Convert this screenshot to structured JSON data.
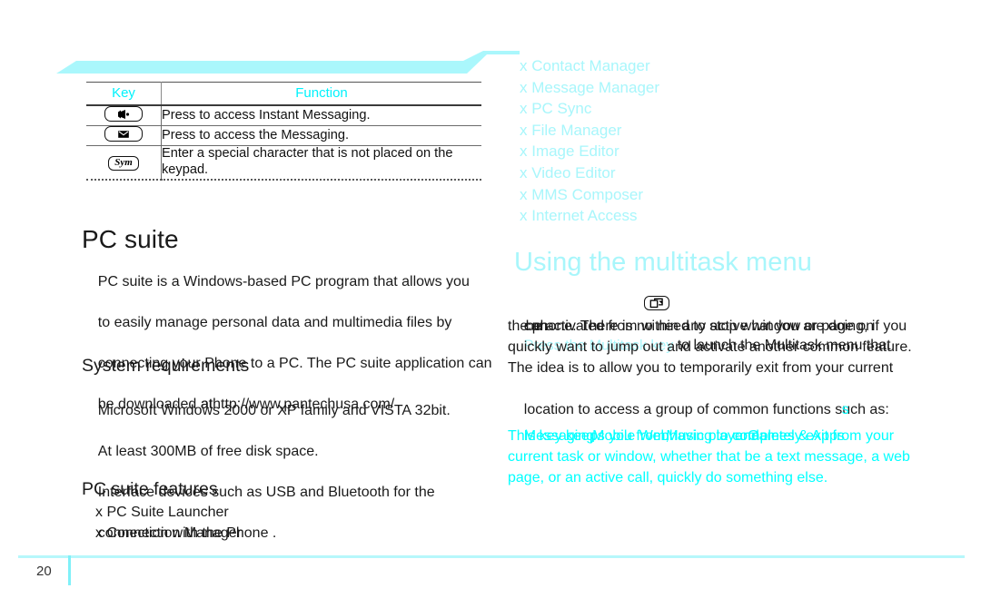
{
  "document": {
    "page_number": "20"
  },
  "banner": {
    "color": "#aaf7fc"
  },
  "key_table": {
    "headers": {
      "key": "Key",
      "function": "Function"
    },
    "header_color": "#00f2fc",
    "rows": [
      {
        "key_icon": "instant-messaging-key-icon",
        "key_label": "",
        "function": "Press to access Instant Messaging."
      },
      {
        "key_icon": "envelope-message-key-icon",
        "key_label": "",
        "function": "Press to access the Messaging."
      },
      {
        "key_icon": "sym-key-icon",
        "key_label": "Sym",
        "function": "Enter a special character that is not placed on the keypad."
      }
    ]
  },
  "left_column": {
    "pc_suite_heading": "PC suite",
    "pc_suite_body_line1": "PC suite is a Windows-based PC program that allows you",
    "pc_suite_body_line2": "to easily manage personal data and multimedia files by",
    "pc_suite_body_line3": "connecting your Phone to a PC. The PC suite application can",
    "pc_suite_body_line4_a": "be downloaded at",
    "pc_suite_body_line4_overlap": "at",
    "pc_suite_body_line4_b": "http://www.pantechusa.com/",
    "system_requirements_heading": "System requirements",
    "system_requirements_lines": [
      "Microsoft Windows 2000 or XP family and VISTA 32bit.",
      "At least 300MB of free disk space.",
      "Interface devices such as USB and Bluetooth for the",
      "connection with the Phone ."
    ],
    "pc_suite_features_heading": "PC suite features",
    "pc_suite_features_items": [
      "x PC Suite Launcher",
      "x Connection Manager"
    ]
  },
  "right_column": {
    "feature_list": [
      "x Contact Manager",
      "x Message Manager",
      "x PC Sync",
      "x File Manager",
      "x Image Editor",
      "x Video Editor",
      "x MMS Composer",
      "x Internet Access"
    ],
    "multitask_heading": "Using the multitask menu",
    "multitask_intro_cyan": "Press the Multitask key",
    "multitask_key_icon": "multitask-key-icon",
    "multitask_body_line1": " to launch the Multitask menu that",
    "multitask_body_line2_overlap": "can",
    "multitask_body_line2": "be activated from within any active window or page on",
    "multitask_body_line3": "the phone. There is no need to stop what you are doing, if you",
    "multitask_body_line4": "quickly want to jump out and activate another common feature.",
    "multitask_body_line5": "The idea is to allow you to temporarily exit from your current",
    "multitask_body_line6": "location to access a group of common functions such as:",
    "multitask_body_line6_overlap": "s",
    "functions_line": {
      "item1": "Messaging",
      "sep1": ",",
      "item2": "Mobile Web",
      "sep2": ",",
      "item3": "Music player",
      "sep3": "and",
      "item4": "Games & Apps"
    },
    "closing_lines": [
      "This key keeps you from having to completely exit from your",
      "current task or window, whether that be a text message, a web",
      "page, or an active call, quickly do something else."
    ]
  },
  "colors": {
    "cyan_soft": "#a8f6fb",
    "cyan_bright": "#00ffff",
    "cyan_header": "#00f2fc",
    "text": "#1a1a1a"
  }
}
